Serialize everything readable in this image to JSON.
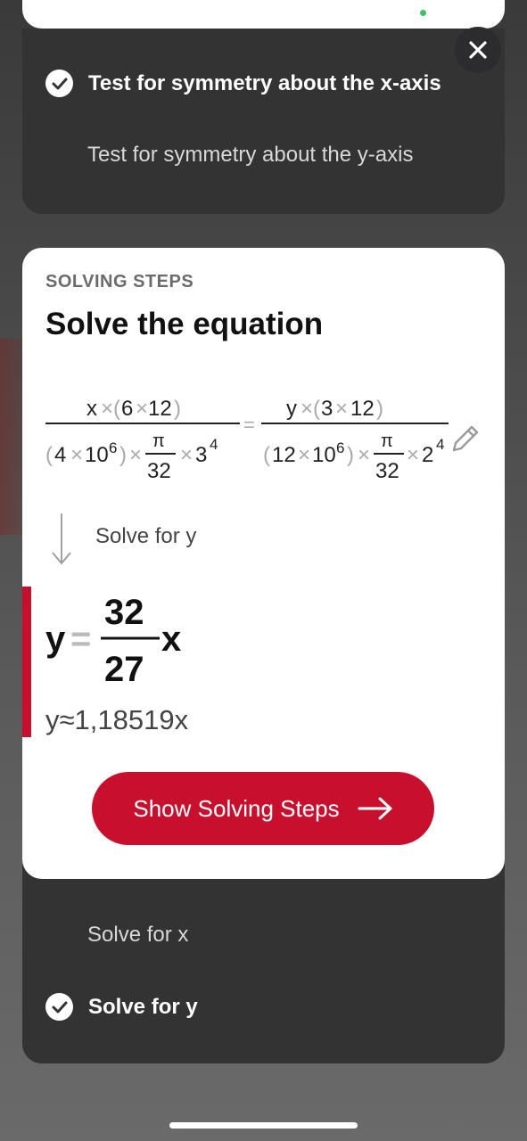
{
  "colors": {
    "accent": "#c8102e",
    "panel": "#333333",
    "card": "#ffffff",
    "status_dot": "#34c759"
  },
  "options_top": [
    {
      "label": "Test for symmetry about the x-axis",
      "selected": true
    },
    {
      "label": "Test for symmetry about the y-axis",
      "selected": false
    }
  ],
  "card": {
    "eyebrow": "SOLVING STEPS",
    "title": "Solve the equation",
    "equation": {
      "lhs_numerator": {
        "var": "x",
        "times": "×",
        "a": "6",
        "b": "12"
      },
      "lhs_denominator": {
        "c": "4",
        "ten": "10",
        "exp": "6",
        "pi": "π",
        "den": "32",
        "base": "3",
        "pow": "4"
      },
      "equals": "=",
      "rhs_numerator": {
        "var": "y",
        "times": "×",
        "a": "3",
        "b": "12"
      },
      "rhs_denominator": {
        "c": "12",
        "ten": "10",
        "exp": "6",
        "pi": "π",
        "den": "32",
        "base": "2",
        "pow": "4"
      }
    },
    "step_label": "Solve for y",
    "result": {
      "var": "y",
      "equals": "=",
      "num": "32",
      "den": "27",
      "var2": "x"
    },
    "approx": "y≈1,18519x",
    "cta_label": "Show Solving Steps"
  },
  "options_bottom": [
    {
      "label": "Solve for x",
      "selected": false
    },
    {
      "label": "Solve for y",
      "selected": true
    }
  ],
  "icons": {
    "close": "close-icon",
    "check": "check-icon",
    "edit": "pencil-icon",
    "down_arrow": "down-arrow-icon",
    "right_arrow": "arrow-right-icon"
  }
}
